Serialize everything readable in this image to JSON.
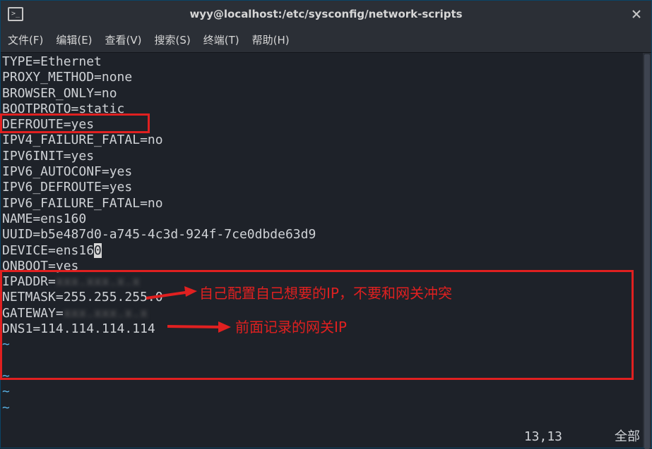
{
  "title": "wyy@localhost:/etc/sysconfig/network-scripts",
  "menu": {
    "file": "文件(F)",
    "edit": "编辑(E)",
    "view": "查看(V)",
    "search": "搜索(S)",
    "terminal": "终端(T)",
    "help": "帮助(H)"
  },
  "content": {
    "lines": [
      "TYPE=Ethernet",
      "PROXY_METHOD=none",
      "BROWSER_ONLY=no",
      "BOOTPROTO=static",
      "DEFROUTE=yes",
      "IPV4_FAILURE_FATAL=no",
      "IPV6INIT=yes",
      "IPV6_AUTOCONF=yes",
      "IPV6_DEFROUTE=yes",
      "IPV6_FAILURE_FATAL=no",
      "NAME=ens160",
      "UUID=b5e487d0-a745-4c3d-924f-7ce0dbde63d9",
      "DEVICE=ens160",
      "ONBOOT=yes",
      "IPADDR=",
      "NETMASK=255.255.255.0",
      "GATEWAY=",
      "DNS1=114.114.114.114"
    ],
    "cursor_line_index": 12,
    "cursor_char_index": 12
  },
  "annotations": {
    "ip_note": "自己配置自己想要的IP，不要和网关冲突",
    "gateway_note": "前面记录的网关IP"
  },
  "status": {
    "position": "13,13",
    "mode": "全部"
  },
  "tilde": "~"
}
